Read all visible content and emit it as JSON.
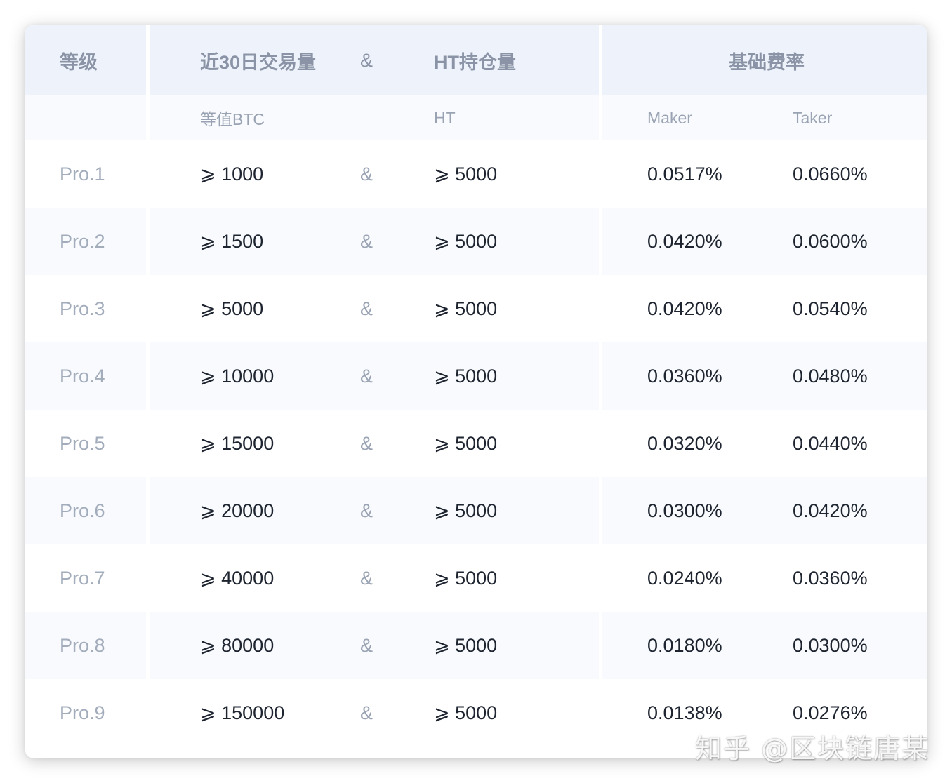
{
  "table": {
    "header": {
      "level": "等级",
      "volume": "近30日交易量",
      "amp": "&",
      "holding": "HT持仓量",
      "base_rate": "基础费率"
    },
    "subheader": {
      "volume_unit": "等值BTC",
      "holding_unit": "HT",
      "maker": "Maker",
      "taker": "Taker"
    },
    "rows": [
      {
        "level": "Pro.1",
        "volume": "⩾ 1000",
        "amp": "&",
        "holding": "⩾ 5000",
        "maker": "0.0517%",
        "taker": "0.0660%"
      },
      {
        "level": "Pro.2",
        "volume": "⩾ 1500",
        "amp": "&",
        "holding": "⩾ 5000",
        "maker": "0.0420%",
        "taker": "0.0600%"
      },
      {
        "level": "Pro.3",
        "volume": "⩾ 5000",
        "amp": "&",
        "holding": "⩾ 5000",
        "maker": "0.0420%",
        "taker": "0.0540%"
      },
      {
        "level": "Pro.4",
        "volume": "⩾ 10000",
        "amp": "&",
        "holding": "⩾ 5000",
        "maker": "0.0360%",
        "taker": "0.0480%"
      },
      {
        "level": "Pro.5",
        "volume": "⩾ 15000",
        "amp": "&",
        "holding": "⩾ 5000",
        "maker": "0.0320%",
        "taker": "0.0440%"
      },
      {
        "level": "Pro.6",
        "volume": "⩾ 20000",
        "amp": "&",
        "holding": "⩾ 5000",
        "maker": "0.0300%",
        "taker": "0.0420%"
      },
      {
        "level": "Pro.7",
        "volume": "⩾ 40000",
        "amp": "&",
        "holding": "⩾ 5000",
        "maker": "0.0240%",
        "taker": "0.0360%"
      },
      {
        "level": "Pro.8",
        "volume": "⩾ 80000",
        "amp": "&",
        "holding": "⩾ 5000",
        "maker": "0.0180%",
        "taker": "0.0300%"
      },
      {
        "level": "Pro.9",
        "volume": "⩾ 150000",
        "amp": "&",
        "holding": "⩾ 5000",
        "maker": "0.0138%",
        "taker": "0.0276%"
      }
    ]
  },
  "watermark": "知乎 @区块链唐某",
  "colors": {
    "header_bg": "#eef3fb",
    "alt_row_bg": "#f8fafd",
    "level_text": "#a2acbb",
    "value_text": "#1e2530"
  }
}
